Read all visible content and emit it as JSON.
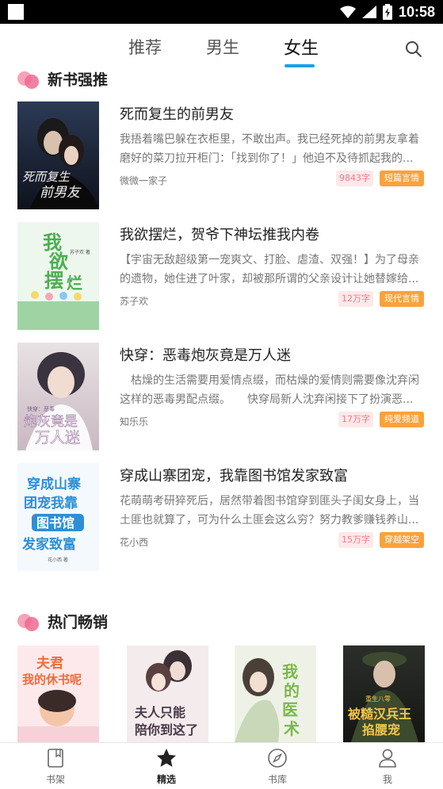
{
  "status_bar": {
    "time": "10:58"
  },
  "tabs": [
    {
      "label": "推荐",
      "active": false
    },
    {
      "label": "男生",
      "active": false
    },
    {
      "label": "女生",
      "active": true
    }
  ],
  "sections": {
    "new_books": {
      "title": "新书强推"
    },
    "hot": {
      "title": "热门畅销"
    }
  },
  "books": [
    {
      "title": "死而复生的前男友",
      "description": "我捂着嘴巴躲在衣柜里，不敢出声。我已经死掉的前男友拿着磨好的菜刀拉开柜门：「找到你了！」他迫不及待抓起我的...",
      "author": "微微一家子",
      "count": "9843字",
      "genre": "短篇言情",
      "cover_text": "死而复生的前男友",
      "cover_small": "微微一家子 著"
    },
    {
      "title": "我欲摆烂，贺爷下神坛推我内卷",
      "description": "【宇宙无敌超级第一宠爽文、打脸、虐渣、双强！】为了母亲的遗物，她住进了叶家，却被那所谓的父亲设计让她替嫁给...",
      "author": "苏子欢",
      "count": "12万字",
      "genre": "现代言情",
      "cover_text": "我欲摆烂",
      "cover_small": "苏子欢 著"
    },
    {
      "title": "快穿：恶毒炮灰竟是万人迷",
      "description": "　枯燥的生活需要用爱情点缀，而枯燥的爱情则需要像沈弃闲这样的恶毒男配点缀。　　快穿局新人沈弃闲接下了扮演恶...",
      "author": "知乐乐",
      "count": "17万字",
      "genre": "纯爱频道",
      "cover_text": "炮灰竟是万人迷",
      "cover_small": "快穿：恶毒"
    },
    {
      "title": "穿成山寨团宠，我靠图书馆发家致富",
      "description": "花萌萌考研猝死后，居然带着图书馆穿到匪头子闺女身上，当土匪也就算了，可为什么土匪会这么穷？努力教爹赚钱养山...",
      "author": "花小西",
      "count": "15万字",
      "genre": "穿越架空",
      "cover_text": "穿成山寨团宠我靠图书馆发家致富",
      "cover_small": "花小西 著"
    }
  ],
  "hot_books": [
    {
      "cover_text": "夫君我的休书呢"
    },
    {
      "cover_text": "夫人只能陪你到这了"
    },
    {
      "cover_text": "我的医术"
    },
    {
      "cover_text": "被糙汉兵王掐腰宠",
      "cover_small": "重生八零"
    }
  ],
  "bottom_nav": [
    {
      "label": "书架",
      "icon": "bookshelf-icon",
      "active": false
    },
    {
      "label": "精选",
      "icon": "star-icon",
      "active": true
    },
    {
      "label": "书库",
      "icon": "compass-icon",
      "active": false
    },
    {
      "label": "我",
      "icon": "user-icon",
      "active": false
    }
  ],
  "colors": {
    "accent": "#1e9fe8",
    "genre_tag": "#f9a23c",
    "count_tag_bg": "#fde8ea",
    "count_tag_text": "#ef7a8a",
    "section_dot": "#f06a8f"
  }
}
